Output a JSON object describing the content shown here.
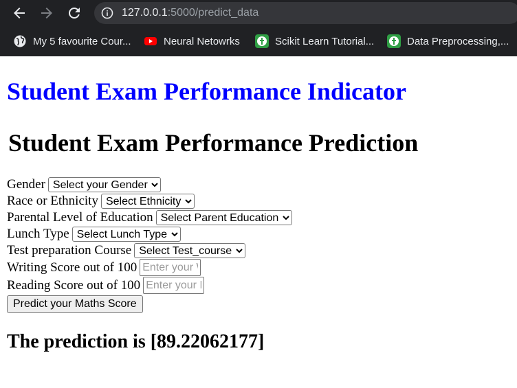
{
  "browser": {
    "url_host": "127.0.0.1",
    "url_rest": ":5000/predict_data",
    "bookmarks": [
      {
        "label": "My 5 favourite Cour...",
        "icon": "globe-icon"
      },
      {
        "label": "Neural Netowrks",
        "icon": "youtube-icon"
      },
      {
        "label": "Scikit Learn Tutorial...",
        "icon": "site-favicon-icon"
      },
      {
        "label": "Data Preprocessing,...",
        "icon": "site-favicon-icon"
      }
    ],
    "colors": {
      "chrome_bg": "#202124",
      "omnibox_bg": "#35363a"
    }
  },
  "page": {
    "site_title": "Student Exam Performance Indicator",
    "heading": "Student Exam Performance Prediction",
    "form": {
      "gender": {
        "label": "Gender",
        "selected": "Select your Gender"
      },
      "ethnicity": {
        "label": "Race or Ethnicity",
        "selected": "Select Ethnicity"
      },
      "parental_education": {
        "label": "Parental Level of Education",
        "selected": "Select Parent Education"
      },
      "lunch": {
        "label": "Lunch Type",
        "selected": "Select Lunch Type"
      },
      "test_prep": {
        "label": "Test preparation Course",
        "selected": "Select Test_course"
      },
      "writing_score": {
        "label": "Writing Score out of 100",
        "placeholder": "Enter your Writing score"
      },
      "reading_score": {
        "label": "Reading Score out of 100",
        "placeholder": "Enter your Reading Score"
      },
      "submit_label": "Predict your Maths Score"
    },
    "result": "The prediction is [89.22062177]",
    "colors": {
      "title": "#0000ff"
    }
  }
}
